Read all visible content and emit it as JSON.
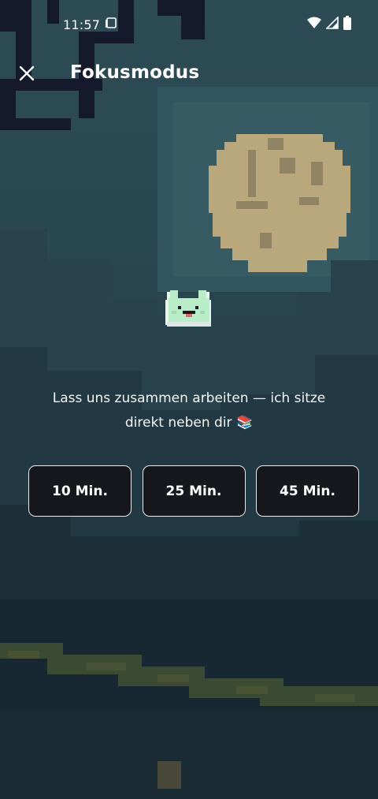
{
  "status_bar": {
    "time": "11:57",
    "icons": [
      "screenshot-icon",
      "wifi-icon",
      "signal-icon",
      "battery-icon"
    ]
  },
  "app_bar": {
    "title": "Fokusmodus",
    "close_icon": "close-icon"
  },
  "main": {
    "message_line1": "Lass uns zusammen arbeiten — ich sitze",
    "message_line2": "direkt neben dir 📚",
    "durations": [
      {
        "label": "10 Min."
      },
      {
        "label": "25 Min."
      },
      {
        "label": "45 Min."
      }
    ]
  },
  "colors": {
    "button_bg": "#17181d",
    "button_border": "#e8eaeb",
    "moon": "#b9a87c",
    "pet": "#b8edc8"
  }
}
